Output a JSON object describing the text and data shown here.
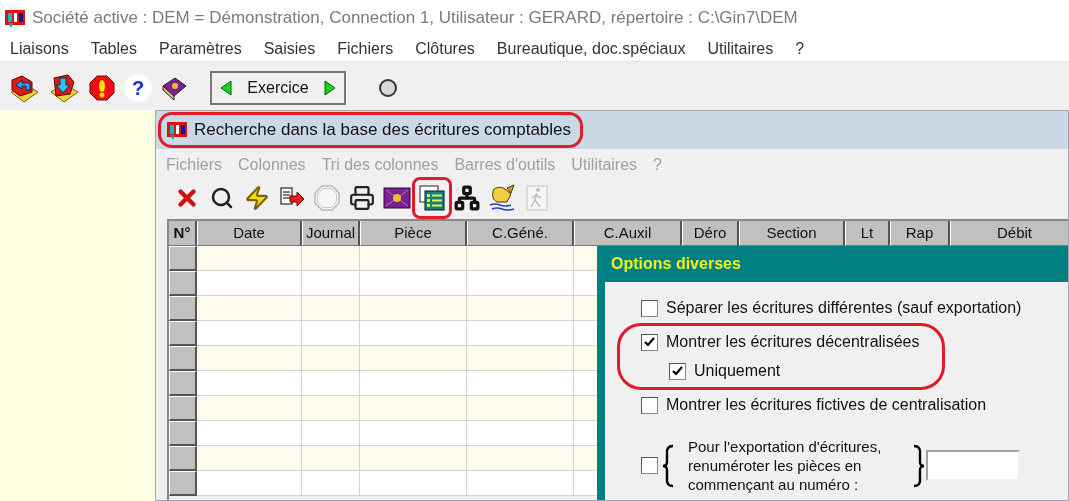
{
  "window": {
    "title": "Société active : DEM = Démonstration, Connection 1, Utilisateur : GERARD, répertoire : C:\\Gin7\\DEM"
  },
  "menu": [
    "Liaisons",
    "Tables",
    "Paramètres",
    "Saisies",
    "Fichiers",
    "Clôtures",
    "Bureautique, doc.spéciaux",
    "Utilitaires",
    "?"
  ],
  "toolbar": {
    "tools": [
      {
        "kind": "open"
      },
      {
        "kind": "import"
      },
      {
        "kind": "alert"
      },
      {
        "kind": "help",
        "label": "?"
      },
      {
        "kind": "book"
      }
    ],
    "exercise_button": "Exercice"
  },
  "search_window": {
    "title": "Recherche dans la base des écritures comptables",
    "highlighted": true,
    "menu": [
      {
        "label": "Fichiers",
        "disabled": true
      },
      {
        "label": "Colonnes",
        "disabled": true
      },
      {
        "label": "Tri des colonnes",
        "disabled": true
      },
      {
        "label": "Barres d'outils",
        "disabled": true
      },
      {
        "label": "Utilitaires",
        "disabled": true
      },
      {
        "label": "?",
        "disabled": true
      }
    ],
    "tools": [
      {
        "kind": "delete",
        "disabled": false,
        "highlighted": false
      },
      {
        "kind": "search",
        "disabled": false,
        "highlighted": false
      },
      {
        "kind": "lightning",
        "disabled": false,
        "highlighted": false
      },
      {
        "kind": "export",
        "disabled": false,
        "highlighted": false
      },
      {
        "kind": "stop",
        "disabled": true,
        "highlighted": false
      },
      {
        "kind": "print",
        "disabled": false,
        "highlighted": false
      },
      {
        "kind": "book",
        "disabled": false,
        "highlighted": false
      },
      {
        "kind": "columns",
        "disabled": false,
        "highlighted": true
      },
      {
        "kind": "tree",
        "disabled": false,
        "highlighted": false
      },
      {
        "kind": "sign",
        "disabled": false,
        "highlighted": false
      },
      {
        "kind": "exit",
        "disabled": true,
        "highlighted": false
      }
    ],
    "table": {
      "columns": [
        "N°",
        "Date",
        "Journal",
        "Pièce",
        "C.Géné.",
        "C.Auxil",
        "Déro",
        "Section",
        "Lt",
        "Rap",
        "Débit"
      ]
    }
  },
  "dialog": {
    "title": "Options diverses",
    "options": [
      {
        "kind": "checkbox",
        "label": "Séparer les écritures différentes (sauf exportation)",
        "checked": false
      },
      {
        "kind": "checkbox",
        "label": "Montrer les écritures décentralisées",
        "checked": true,
        "highlighted": true,
        "children": [
          {
            "kind": "checkbox",
            "label": "Uniquement",
            "checked": true
          }
        ]
      },
      {
        "kind": "checkbox",
        "label": "Montrer les écritures fictives de centralisation",
        "checked": false
      },
      {
        "kind": "numbering",
        "label": "Pour l'exportation d'écritures, renuméroter les pièces en commençant au numéro :",
        "checked": false
      }
    ]
  }
}
